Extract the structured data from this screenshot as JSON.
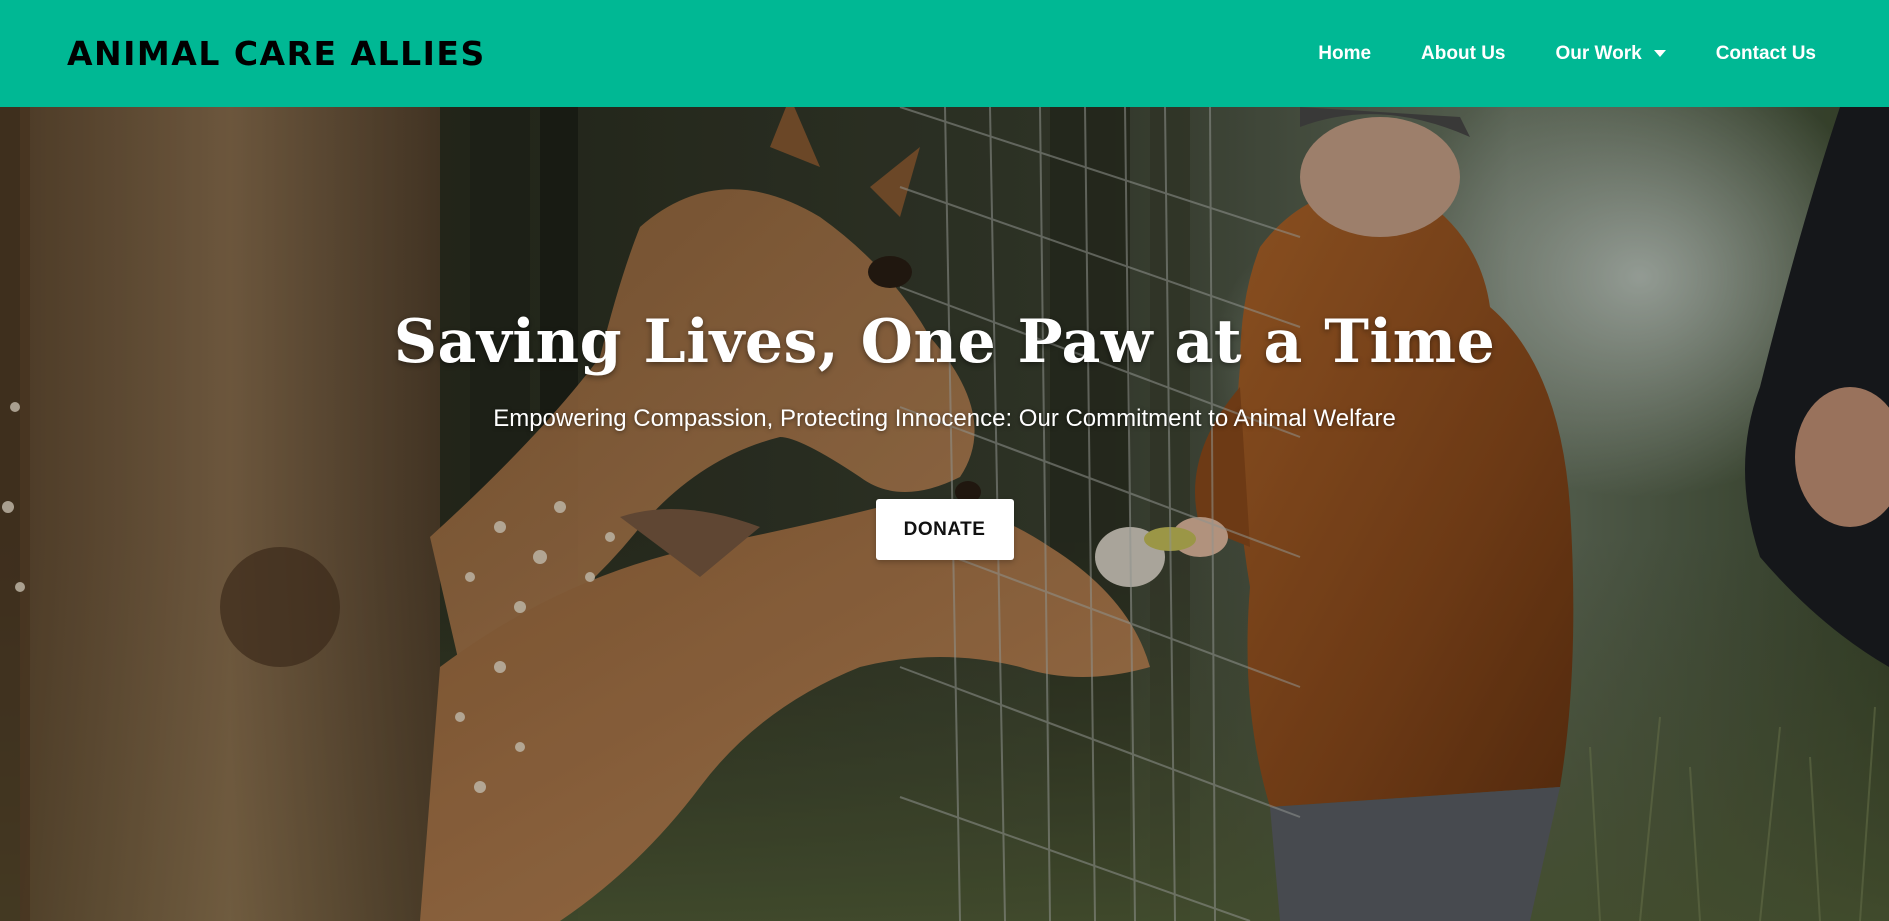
{
  "navbar": {
    "brand": "ANIMAL CARE ALLIES",
    "background_color": "#00b894",
    "links": [
      {
        "label": "Home"
      },
      {
        "label": "About Us"
      },
      {
        "label": "Our Work",
        "has_dropdown": true
      },
      {
        "label": "Contact Us"
      }
    ]
  },
  "hero": {
    "title": "Saving Lives, One Paw at a Time",
    "subtitle": "Empowering Compassion, Protecting Innocence: Our Commitment to Animal Welfare",
    "button_label": "DONATE",
    "background": "photo of a child feeding fallow deer through a wire fence"
  },
  "icons": {
    "dropdown": "caret-down-icon"
  }
}
